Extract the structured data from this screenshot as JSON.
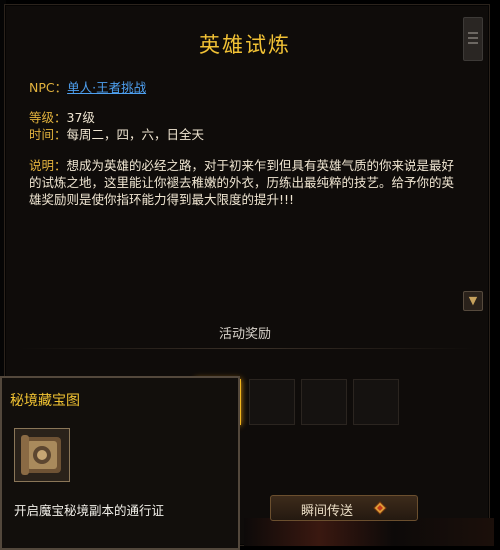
{
  "window": {
    "title": "英雄试炼"
  },
  "info": {
    "npc_label": "NPC：",
    "npc_value": "单人·王者挑战",
    "level_label": "等级：",
    "level_value": "37级",
    "time_label": "时间：",
    "time_value": "每周二，四，六，日全天",
    "desc_label": "说明：",
    "desc_value": "想成为英雄的必经之路，对于初来乍到但具有英雄气质的你来说是最好的试炼之地，这里能让你褪去稚嫩的外衣，历练出最纯粹的技艺。给予你的英雄奖励则是使你指环能力得到最大限度的提升!!!"
  },
  "rewards": {
    "label": "活动奖励",
    "slots": [
      {
        "icon": "treasure-map-icon",
        "state": "dim"
      },
      {
        "icon": "red-orb-icon",
        "state": "dim"
      },
      {
        "icon": "rune-cluster-icon",
        "state": "dim"
      },
      {
        "icon": "treasure-map-icon",
        "state": "selected"
      },
      {
        "icon": "",
        "state": "empty"
      },
      {
        "icon": "",
        "state": "empty"
      },
      {
        "icon": "",
        "state": "empty"
      }
    ]
  },
  "tooltip": {
    "title": "秘境藏宝图",
    "icon": "treasure-map-icon",
    "description": "开启魔宝秘境副本的通行证"
  },
  "actions": {
    "teleport_label": "瞬间传送"
  },
  "colors": {
    "title": "#f2c235",
    "label": "#e2b23d",
    "link": "#4ea0f0",
    "selected_border": "#f3b51d"
  }
}
